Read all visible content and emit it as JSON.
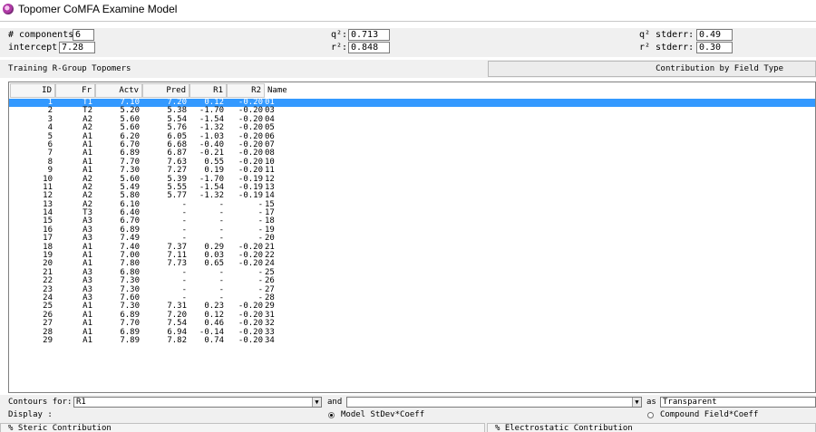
{
  "window": {
    "title": "Topomer CoMFA Examine Model"
  },
  "params": {
    "components_label": "# components:",
    "components_value": "6",
    "intercept_label": "intercept:",
    "intercept_value": "7.28",
    "q2_label": "q²:",
    "q2_value": "0.713",
    "r2_label": "r²:",
    "r2_value": "0.848",
    "q2_stderr_label": "q² stderr:",
    "q2_stderr_value": "0.49",
    "r2_stderr_label": "r² stderr:",
    "r2_stderr_value": "0.30"
  },
  "section": {
    "training_label": "Training R-Group Topomers",
    "contribution_button": "Contribution by Field Type"
  },
  "table": {
    "columns": [
      "ID",
      "Fr",
      "Actv",
      "Pred",
      "R1",
      "R2",
      "Name"
    ],
    "rows": [
      {
        "id": "1",
        "fr": "T1",
        "actv": "7.10",
        "pred": "7.20",
        "r1": "0.12",
        "r2": "-0.20",
        "name": "01",
        "selected": true
      },
      {
        "id": "2",
        "fr": "T2",
        "actv": "5.20",
        "pred": "5.38",
        "r1": "-1.70",
        "r2": "-0.20",
        "name": "03"
      },
      {
        "id": "3",
        "fr": "A2",
        "actv": "5.60",
        "pred": "5.54",
        "r1": "-1.54",
        "r2": "-0.20",
        "name": "04"
      },
      {
        "id": "4",
        "fr": "A2",
        "actv": "5.60",
        "pred": "5.76",
        "r1": "-1.32",
        "r2": "-0.20",
        "name": "05"
      },
      {
        "id": "5",
        "fr": "A1",
        "actv": "6.20",
        "pred": "6.05",
        "r1": "-1.03",
        "r2": "-0.20",
        "name": "06"
      },
      {
        "id": "6",
        "fr": "A1",
        "actv": "6.70",
        "pred": "6.68",
        "r1": "-0.40",
        "r2": "-0.20",
        "name": "07"
      },
      {
        "id": "7",
        "fr": "A1",
        "actv": "6.89",
        "pred": "6.87",
        "r1": "-0.21",
        "r2": "-0.20",
        "name": "08"
      },
      {
        "id": "8",
        "fr": "A1",
        "actv": "7.70",
        "pred": "7.63",
        "r1": "0.55",
        "r2": "-0.20",
        "name": "10"
      },
      {
        "id": "9",
        "fr": "A1",
        "actv": "7.30",
        "pred": "7.27",
        "r1": "0.19",
        "r2": "-0.20",
        "name": "11"
      },
      {
        "id": "10",
        "fr": "A2",
        "actv": "5.60",
        "pred": "5.39",
        "r1": "-1.70",
        "r2": "-0.19",
        "name": "12"
      },
      {
        "id": "11",
        "fr": "A2",
        "actv": "5.49",
        "pred": "5.55",
        "r1": "-1.54",
        "r2": "-0.19",
        "name": "13"
      },
      {
        "id": "12",
        "fr": "A2",
        "actv": "5.80",
        "pred": "5.77",
        "r1": "-1.32",
        "r2": "-0.19",
        "name": "14"
      },
      {
        "id": "13",
        "fr": "A2",
        "actv": "6.10",
        "pred": "-",
        "r1": "-",
        "r2": "-",
        "name": "15"
      },
      {
        "id": "14",
        "fr": "T3",
        "actv": "6.40",
        "pred": "-",
        "r1": "-",
        "r2": "-",
        "name": "17"
      },
      {
        "id": "15",
        "fr": "A3",
        "actv": "6.70",
        "pred": "-",
        "r1": "-",
        "r2": "-",
        "name": "18"
      },
      {
        "id": "16",
        "fr": "A3",
        "actv": "6.89",
        "pred": "-",
        "r1": "-",
        "r2": "-",
        "name": "19"
      },
      {
        "id": "17",
        "fr": "A3",
        "actv": "7.49",
        "pred": "-",
        "r1": "-",
        "r2": "-",
        "name": "20"
      },
      {
        "id": "18",
        "fr": "A1",
        "actv": "7.40",
        "pred": "7.37",
        "r1": "0.29",
        "r2": "-0.20",
        "name": "21"
      },
      {
        "id": "19",
        "fr": "A1",
        "actv": "7.00",
        "pred": "7.11",
        "r1": "0.03",
        "r2": "-0.20",
        "name": "22"
      },
      {
        "id": "20",
        "fr": "A1",
        "actv": "7.80",
        "pred": "7.73",
        "r1": "0.65",
        "r2": "-0.20",
        "name": "24"
      },
      {
        "id": "21",
        "fr": "A3",
        "actv": "6.80",
        "pred": "-",
        "r1": "-",
        "r2": "-",
        "name": "25"
      },
      {
        "id": "22",
        "fr": "A3",
        "actv": "7.30",
        "pred": "-",
        "r1": "-",
        "r2": "-",
        "name": "26"
      },
      {
        "id": "23",
        "fr": "A3",
        "actv": "7.30",
        "pred": "-",
        "r1": "-",
        "r2": "-",
        "name": "27"
      },
      {
        "id": "24",
        "fr": "A3",
        "actv": "7.60",
        "pred": "-",
        "r1": "-",
        "r2": "-",
        "name": "28"
      },
      {
        "id": "25",
        "fr": "A1",
        "actv": "7.30",
        "pred": "7.31",
        "r1": "0.23",
        "r2": "-0.20",
        "name": "29"
      },
      {
        "id": "26",
        "fr": "A1",
        "actv": "6.89",
        "pred": "7.20",
        "r1": "0.12",
        "r2": "-0.20",
        "name": "31"
      },
      {
        "id": "27",
        "fr": "A1",
        "actv": "7.70",
        "pred": "7.54",
        "r1": "0.46",
        "r2": "-0.20",
        "name": "32"
      },
      {
        "id": "28",
        "fr": "A1",
        "actv": "6.89",
        "pred": "6.94",
        "r1": "-0.14",
        "r2": "-0.20",
        "name": "33"
      },
      {
        "id": "29",
        "fr": "A1",
        "actv": "7.89",
        "pred": "7.82",
        "r1": "0.74",
        "r2": "-0.20",
        "name": "34"
      }
    ]
  },
  "bottom": {
    "contours_label": "Contours for:",
    "contours_value": "R1",
    "and_label": "and",
    "and_value": "",
    "as_label": "as",
    "as_value": "Transparent",
    "display_label": "Display :",
    "radio_model": "Model StDev*Coeff",
    "radio_model_checked": true,
    "radio_compound": "Compound Field*Coeff",
    "radio_compound_checked": false,
    "steric_tab": "% Steric Contribution",
    "electrostatic_tab": "% Electrostatic Contribution"
  },
  "colors": {
    "selection": "#3399ff",
    "background": "#f0f0f0"
  }
}
